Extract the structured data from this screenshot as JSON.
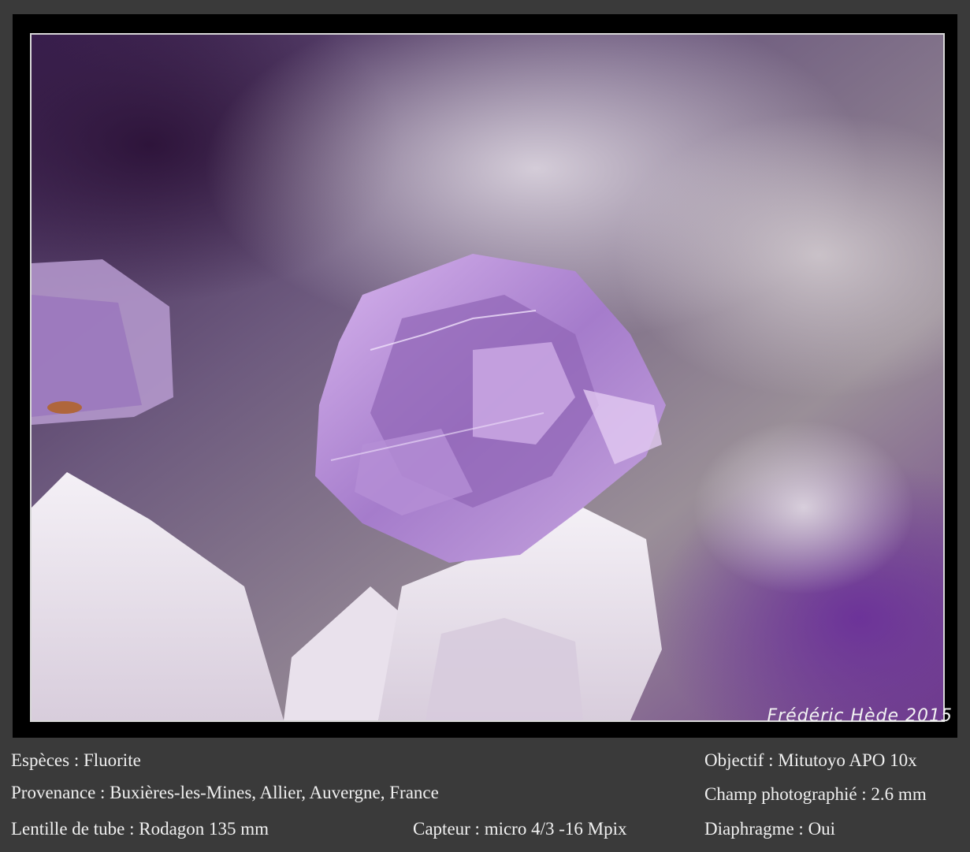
{
  "photo": {
    "subject": "fluorite-crystal-micro-photo"
  },
  "credit": "Frédéric Hède 2015",
  "captions": {
    "especes": "Espèces : Fluorite",
    "objectif": "Objectif : Mitutoyo APO 10x",
    "provenance": "Provenance : Buxières-les-Mines, Allier, Auvergne, France",
    "champ": "Champ photographié : 2.6 mm",
    "lentille": "Lentille de tube : Rodagon 135 mm",
    "capteur": "Capteur : micro 4/3 -16 Mpix",
    "diaphragme": "Diaphragme : Oui"
  }
}
